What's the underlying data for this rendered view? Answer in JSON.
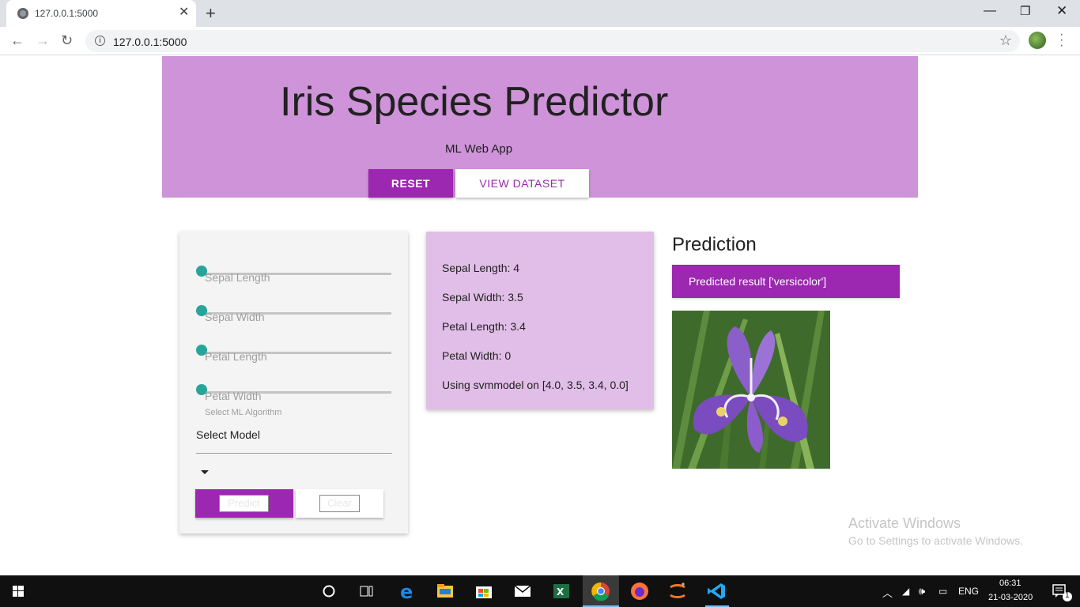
{
  "browser": {
    "tab_title": "127.0.0.1:5000",
    "url": "127.0.0.1:5000"
  },
  "header": {
    "title": "Iris Species Predictor",
    "subtitle": "ML Web App",
    "reset_label": "RESET",
    "view_dataset_label": "VIEW DATASET"
  },
  "form": {
    "sliders": [
      {
        "label": "Sepal Length"
      },
      {
        "label": "Sepal Width"
      },
      {
        "label": "Petal Length"
      },
      {
        "label": "Petal Width"
      }
    ],
    "select_caption": "Select ML Algorithm",
    "select_value": "Select Model",
    "predict_label": "Predict",
    "clear_label": "Clear"
  },
  "values": {
    "sepal_length": "Sepal Length: 4",
    "sepal_width": "Sepal Width: 3.5",
    "petal_length": "Petal Length: 3.4",
    "petal_width": "Petal Width: 0",
    "model_line": "Using svmmodel on [4.0, 3.5, 3.4, 0.0]"
  },
  "prediction": {
    "heading": "Prediction",
    "result": "Predicted result ['versicolor']"
  },
  "watermark": {
    "line1": "Activate Windows",
    "line2": "Go to Settings to activate Windows."
  },
  "taskbar": {
    "language": "ENG",
    "time": "06:31",
    "date": "21-03-2020",
    "notification_count": "1",
    "apps": [
      "start-icon",
      "cortana-icon",
      "task-view-icon",
      "edge-icon",
      "file-explorer-icon",
      "store-icon",
      "mail-icon",
      "excel-icon",
      "chrome-icon",
      "firefox-icon",
      "jupyter-icon",
      "vscode-icon"
    ]
  },
  "colors": {
    "primary": "#9c27b0",
    "header_bg": "#ce93d8",
    "values_bg": "#e1bee7",
    "slider_thumb": "#26a69a"
  }
}
